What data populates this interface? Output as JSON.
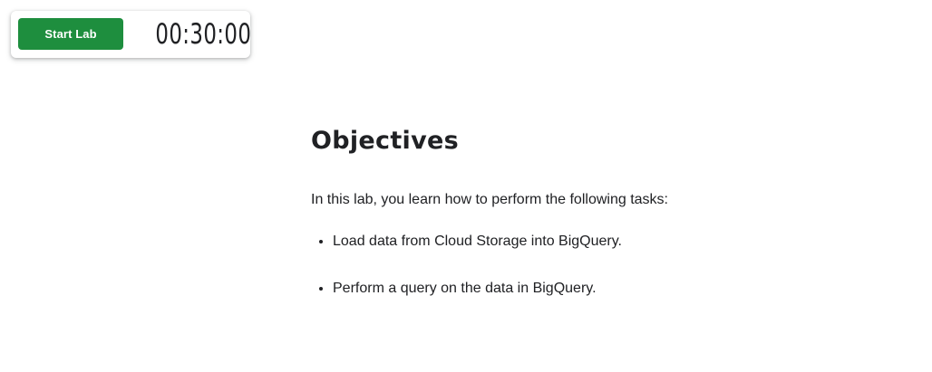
{
  "lab_control": {
    "start_label": "Start Lab",
    "timer": "00:30:00",
    "accent_color": "#1e8e3e"
  },
  "main": {
    "heading": "Objectives",
    "intro": "In this lab, you learn how to perform the following tasks:",
    "tasks": [
      "Load data from Cloud Storage into BigQuery.",
      "Perform a query on the data in BigQuery."
    ]
  }
}
